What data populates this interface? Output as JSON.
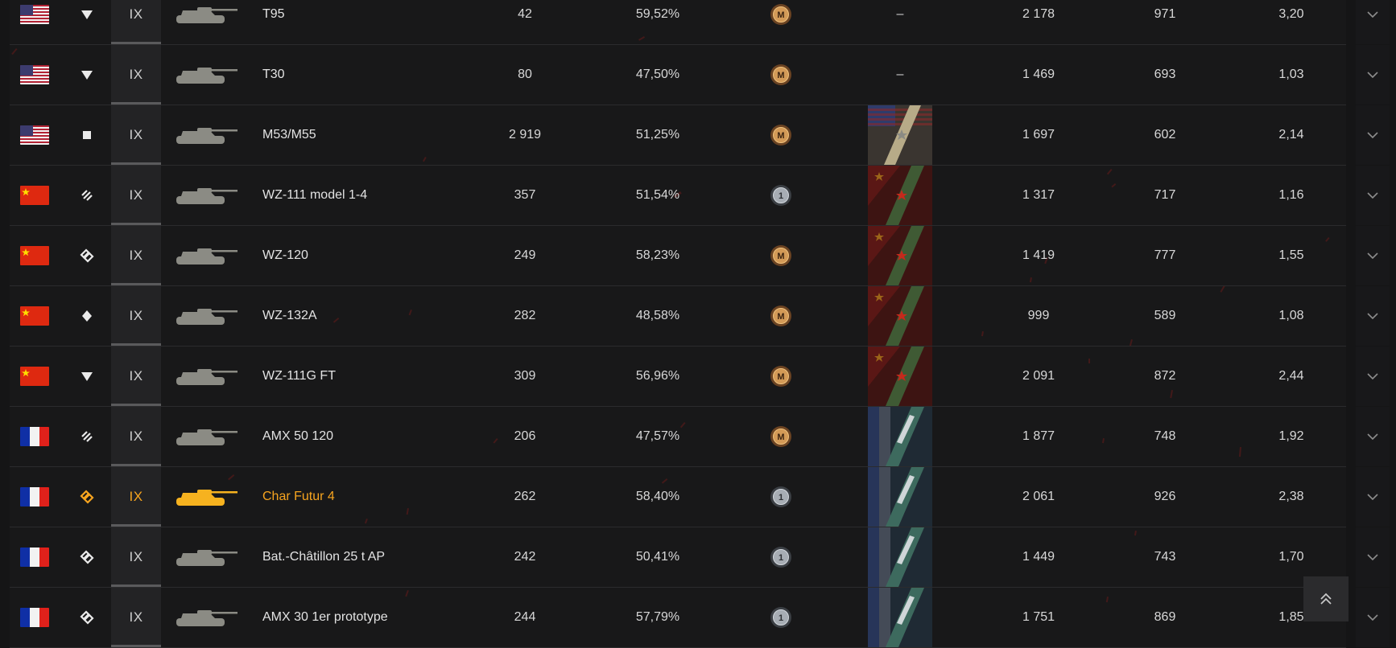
{
  "colors": {
    "background": "#151516",
    "row_bg": "#1c1c1e",
    "text": "#d8d8d8",
    "highlight": "#f6a41f",
    "tank_silhouette": "#8b8b84",
    "tank_highlight": "#f6b21f"
  },
  "rows": [
    {
      "nation": "usa",
      "class_icon": "heavy-tank-icon",
      "tier": "IX",
      "name": "T95",
      "battles": "42",
      "winrate": "59,52%",
      "mastery": "mastery-badge-m-icon",
      "mark": "–",
      "avg_damage": "2 178",
      "avg_xp": "971",
      "kd": "3,20",
      "highlight": false
    },
    {
      "nation": "usa",
      "class_icon": "heavy-tank-icon",
      "tier": "IX",
      "name": "T30",
      "battles": "80",
      "winrate": "47,50%",
      "mastery": "mastery-badge-m-icon",
      "mark": "–",
      "avg_damage": "1 469",
      "avg_xp": "693",
      "kd": "1,03",
      "highlight": false
    },
    {
      "nation": "usa",
      "class_icon": "artillery-icon",
      "tier": "IX",
      "name": "M53/M55",
      "battles": "2 919",
      "winrate": "51,25%",
      "mastery": "mastery-badge-m-icon",
      "mark": "usa-marks-of-excellence",
      "avg_damage": "1 697",
      "avg_xp": "602",
      "kd": "2,14",
      "highlight": false
    },
    {
      "nation": "china",
      "class_icon": "heavy-tank-icon",
      "tier": "IX",
      "name": "WZ-111 model 1-4",
      "battles": "357",
      "winrate": "51,54%",
      "mastery": "mastery-badge-1-icon",
      "mark": "china-marks-of-excellence",
      "avg_damage": "1 317",
      "avg_xp": "717",
      "kd": "1,16",
      "highlight": false
    },
    {
      "nation": "china",
      "class_icon": "medium-tank-icon",
      "tier": "IX",
      "name": "WZ-120",
      "battles": "249",
      "winrate": "58,23%",
      "mastery": "mastery-badge-m-icon",
      "mark": "china-marks-of-excellence",
      "avg_damage": "1 419",
      "avg_xp": "777",
      "kd": "1,55",
      "highlight": false
    },
    {
      "nation": "china",
      "class_icon": "light-tank-icon",
      "tier": "IX",
      "name": "WZ-132A",
      "battles": "282",
      "winrate": "48,58%",
      "mastery": "mastery-badge-m-icon",
      "mark": "china-marks-of-excellence",
      "avg_damage": "999",
      "avg_xp": "589",
      "kd": "1,08",
      "highlight": false
    },
    {
      "nation": "china",
      "class_icon": "tank-destroyer-icon",
      "tier": "IX",
      "name": "WZ-111G FT",
      "battles": "309",
      "winrate": "56,96%",
      "mastery": "mastery-badge-m-icon",
      "mark": "china-marks-of-excellence",
      "avg_damage": "2 091",
      "avg_xp": "872",
      "kd": "2,44",
      "highlight": false
    },
    {
      "nation": "france",
      "class_icon": "heavy-tank-icon",
      "tier": "IX",
      "name": "AMX 50 120",
      "battles": "206",
      "winrate": "47,57%",
      "mastery": "mastery-badge-m-icon",
      "mark": "france-marks-of-excellence",
      "avg_damage": "1 877",
      "avg_xp": "748",
      "kd": "1,92",
      "highlight": false
    },
    {
      "nation": "france",
      "class_icon": "medium-tank-icon",
      "tier": "IX",
      "name": "Char Futur 4",
      "battles": "262",
      "winrate": "58,40%",
      "mastery": "mastery-badge-1-icon",
      "mark": "france-marks-of-excellence",
      "avg_damage": "2 061",
      "avg_xp": "926",
      "kd": "2,38",
      "highlight": true
    },
    {
      "nation": "france",
      "class_icon": "medium-tank-icon",
      "tier": "IX",
      "name": "Bat.-Châtillon 25 t AP",
      "battles": "242",
      "winrate": "50,41%",
      "mastery": "mastery-badge-1-icon",
      "mark": "france-marks-of-excellence",
      "avg_damage": "1 449",
      "avg_xp": "743",
      "kd": "1,70",
      "highlight": false
    },
    {
      "nation": "france",
      "class_icon": "medium-tank-icon",
      "tier": "IX",
      "name": "AMX 30 1er prototype",
      "battles": "244",
      "winrate": "57,79%",
      "mastery": "mastery-badge-1-icon",
      "mark": "france-marks-of-excellence",
      "avg_damage": "1 751",
      "avg_xp": "869",
      "kd": "1,85",
      "highlight": false
    }
  ],
  "scroll_top_icon": "double-chevron-up-icon",
  "expand_icon": "chevron-down-icon"
}
